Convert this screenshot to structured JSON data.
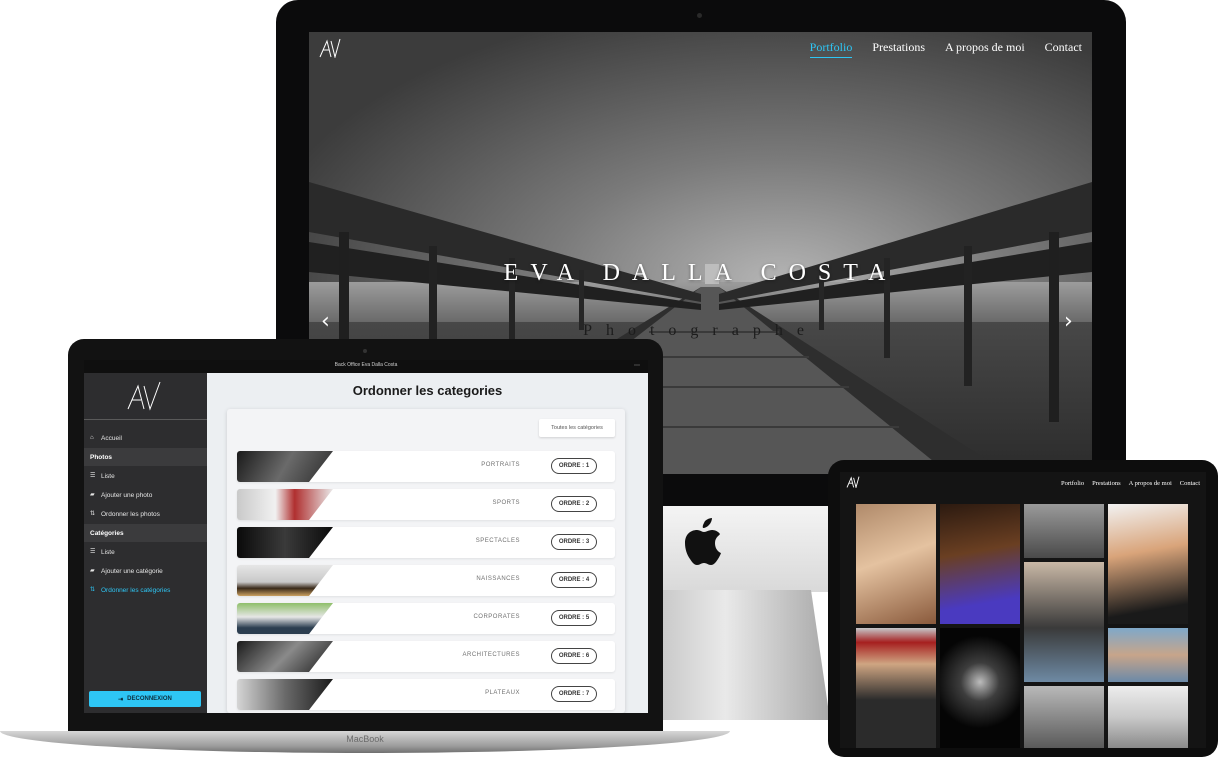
{
  "imac": {
    "nav": {
      "items": [
        "Portfolio",
        "Prestations",
        "A propos de moi",
        "Contact"
      ],
      "active_index": 0
    },
    "hero": {
      "title": "EVA DALLA COSTA",
      "subtitle": "Photographe"
    },
    "arrows": {
      "prev": "‹",
      "next": "›"
    },
    "logo_icon": "av-monogram-icon",
    "accent": "#2ec6f5"
  },
  "macbook": {
    "window_title": "Back Office Eva Dalla Costa",
    "base_label": "MacBook",
    "sidebar": {
      "home": {
        "label": "Accueil",
        "icon": "home-icon"
      },
      "sections": [
        {
          "title": "Photos",
          "items": [
            {
              "label": "Liste",
              "icon": "list-icon"
            },
            {
              "label": "Ajouter une photo",
              "icon": "folder-plus-icon"
            },
            {
              "label": "Ordonner les photos",
              "icon": "sort-icon"
            }
          ]
        },
        {
          "title": "Catégories",
          "items": [
            {
              "label": "Liste",
              "icon": "list-icon"
            },
            {
              "label": "Ajouter une catégorie",
              "icon": "folder-plus-icon"
            },
            {
              "label": "Ordonner les catégories",
              "icon": "sort-icon",
              "active": true
            }
          ]
        }
      ],
      "logout": "DECONNEXION"
    },
    "main": {
      "title": "Ordonner les categories",
      "filter": "Toutes les catégories",
      "rows": [
        {
          "category": "PORTRAITS",
          "order": "ORDRE : 1"
        },
        {
          "category": "SPORTS",
          "order": "ORDRE : 2"
        },
        {
          "category": "SPECTACLES",
          "order": "ORDRE : 3"
        },
        {
          "category": "NAISSANCES",
          "order": "ORDRE : 4"
        },
        {
          "category": "CORPORATES",
          "order": "ORDRE : 5"
        },
        {
          "category": "ARCHITECTURES",
          "order": "ORDRE : 6"
        },
        {
          "category": "PLATEAUX",
          "order": "ORDRE : 7"
        }
      ]
    }
  },
  "ipad": {
    "nav": [
      "Portfolio",
      "Prestations",
      "A propos de moi",
      "Contact"
    ]
  }
}
